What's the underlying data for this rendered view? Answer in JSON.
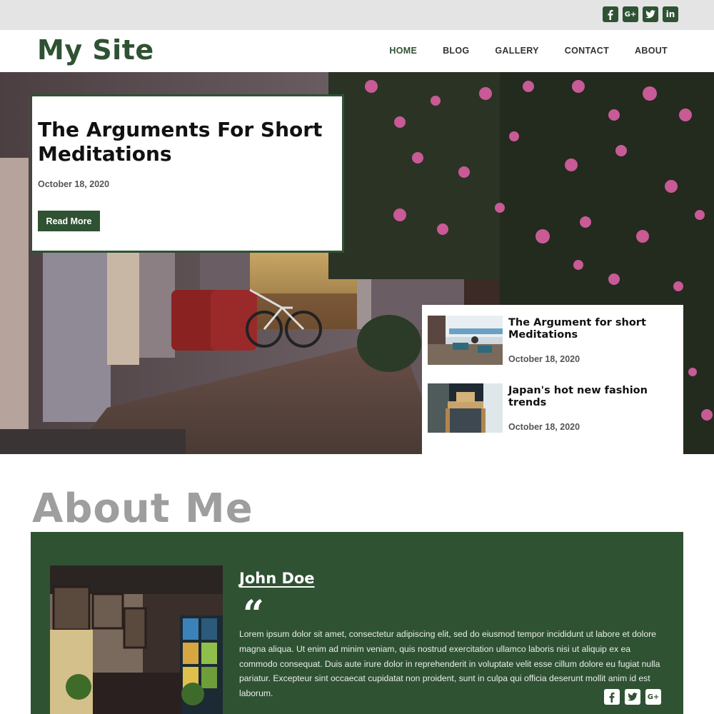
{
  "topbar": {
    "social_icons": [
      "facebook-icon",
      "google-plus-icon",
      "twitter-icon",
      "linkedin-icon"
    ],
    "google_plus_text": "G+",
    "linkedin_text": "in"
  },
  "header": {
    "logo": "My Site",
    "nav": [
      "HOME",
      "BLOG",
      "GALLERY",
      "CONTACT",
      "ABOUT"
    ],
    "active_nav": "HOME"
  },
  "hero": {
    "feature": {
      "title": "The Arguments For Short Meditations",
      "date": "October 18, 2020",
      "button": "Read More"
    },
    "side_posts": [
      {
        "title": "The Argument for short Meditations",
        "date": "October 18, 2020"
      },
      {
        "title": "Japan's hot new fashion trends",
        "date": "October 18, 2020"
      }
    ]
  },
  "about": {
    "heading": "About Me",
    "name": "John Doe",
    "quote_glyph": "“",
    "text": "Lorem ipsum dolor sit amet, consectetur adipiscing elit, sed do eiusmod tempor incididunt ut labore et dolore magna aliqua. Ut enim ad minim veniam, quis nostrud exercitation ullamco laboris nisi ut aliquip ex ea commodo consequat. Duis aute irure dolor in reprehenderit in voluptate velit esse cillum dolore eu fugiat nulla pariatur. Excepteur sint occaecat cupidatat non proident, sunt in culpa qui officia deserunt mollit anim id est laborum.",
    "social_icons": [
      "facebook-icon",
      "twitter-icon",
      "google-plus-icon"
    ],
    "google_plus_text": "G+"
  },
  "colors": {
    "brand_green": "#2f5233",
    "topbar_gray": "#e4e4e4",
    "heading_gray": "#9e9e9e"
  }
}
